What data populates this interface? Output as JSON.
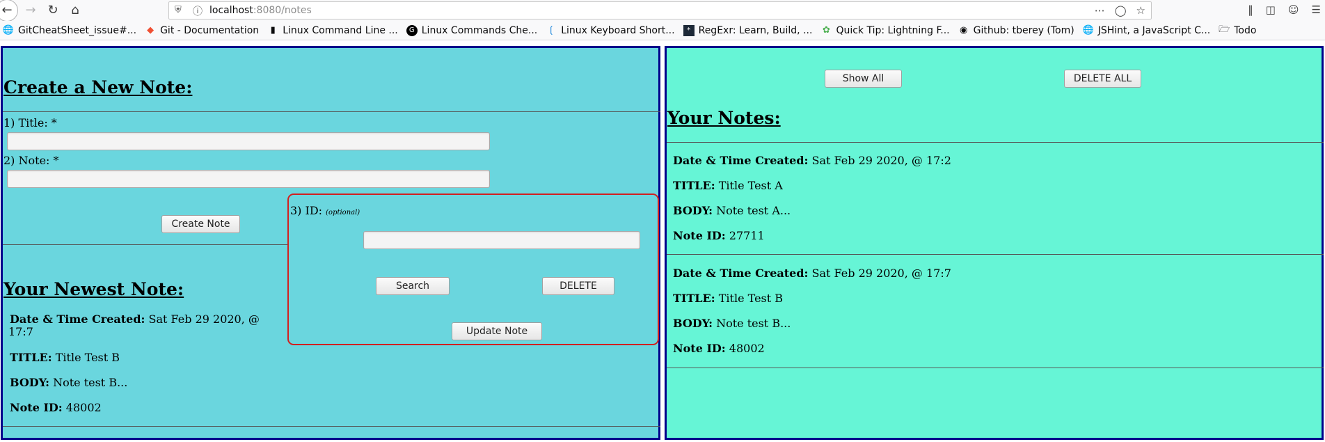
{
  "browser": {
    "url_host": "localhost",
    "url_path": ":8080/notes",
    "bookmarks": [
      {
        "icon": "globe-icon",
        "label": "GitCheatSheet_issue#..."
      },
      {
        "icon": "git-icon",
        "label": "Git - Documentation"
      },
      {
        "icon": "terminal-icon",
        "label": "Linux Command Line ..."
      },
      {
        "icon": "g-icon",
        "label": "Linux Commands Che..."
      },
      {
        "icon": "vscode-icon",
        "label": "Linux Keyboard Short..."
      },
      {
        "icon": "regex-icon",
        "label": "RegExr: Learn, Build, ..."
      },
      {
        "icon": "leaf-icon",
        "label": "Quick Tip: Lightning F..."
      },
      {
        "icon": "github-icon",
        "label": "Github: tberey (Tom)"
      },
      {
        "icon": "globe-icon",
        "label": "JSHint, a JavaScript C..."
      },
      {
        "icon": "folder-icon",
        "label": "Todo"
      }
    ]
  },
  "create": {
    "heading": "Create a New Note:",
    "title_label": "1) Title: *",
    "note_label": "2) Note: *",
    "create_button": "Create Note"
  },
  "id_box": {
    "label": "3) ID:",
    "optional": "(optional)",
    "search_button": "Search",
    "delete_button": "DELETE",
    "update_button": "Update Note"
  },
  "newest": {
    "heading": "Your Newest Note:",
    "date_label": "Date & Time Created:",
    "date_value": "Sat Feb 29 2020, @",
    "date_value_cont": "17:7",
    "title_label": "TITLE:",
    "title_value": "Title Test B",
    "body_label": "BODY:",
    "body_value": "Note test B...",
    "id_label": "Note ID:",
    "id_value": "48002"
  },
  "notes_panel": {
    "show_all_button": "Show All",
    "delete_all_button": "DELETE ALL",
    "heading": "Your Notes:",
    "notes": [
      {
        "date_label": "Date & Time Created:",
        "date_value": "Sat Feb 29 2020, @ 17:2",
        "title_label": "TITLE:",
        "title_value": "Title Test A",
        "body_label": "BODY:",
        "body_value": "Note test A...",
        "id_label": "Note ID:",
        "id_value": "27711"
      },
      {
        "date_label": "Date & Time Created:",
        "date_value": "Sat Feb 29 2020, @ 17:7",
        "title_label": "TITLE:",
        "title_value": "Title Test B",
        "body_label": "BODY:",
        "body_value": "Note test B...",
        "id_label": "Note ID:",
        "id_value": "48002"
      }
    ]
  },
  "colors": {
    "left_panel_bg": "#6ad6de",
    "right_panel_bg": "#66f5d6",
    "panel_border": "#00008b",
    "id_box_border": "#d21f1f"
  }
}
